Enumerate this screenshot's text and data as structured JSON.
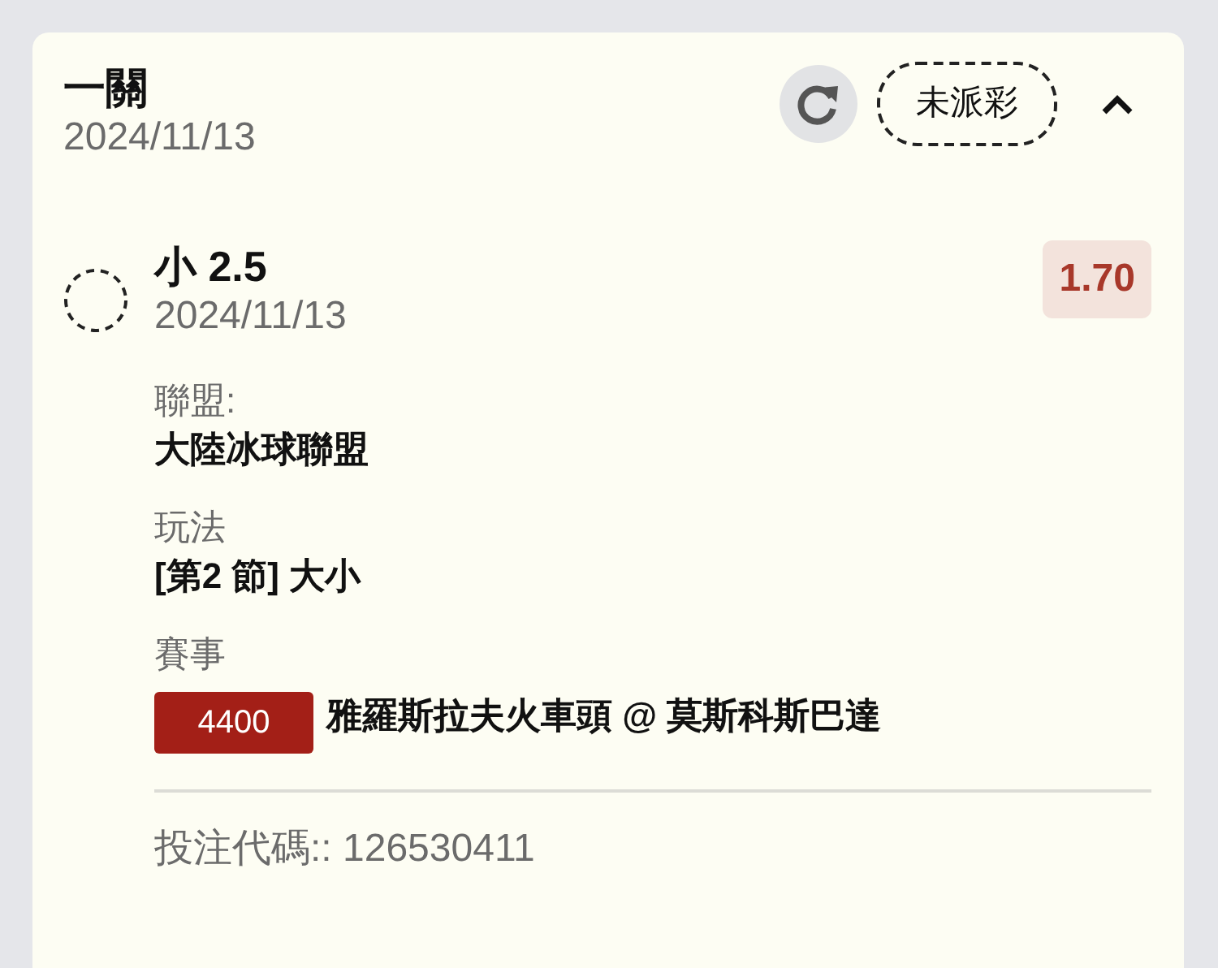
{
  "bet": {
    "title": "一關",
    "date": "2024/11/13",
    "status": "未派彩",
    "expanded": true
  },
  "selection": {
    "name": "小 2.5",
    "date": "2024/11/13",
    "odds": "1.70"
  },
  "details": [
    {
      "kind": "text",
      "label": "聯盟:",
      "value": "大陸冰球聯盟"
    },
    {
      "kind": "text",
      "label": "玩法",
      "value": "[第2 節] 大小"
    },
    {
      "kind": "event",
      "label": "賽事",
      "event_id": "4400",
      "value": "雅羅斯拉夫火車頭 @ 莫斯科斯巴達"
    }
  ],
  "bet_code": "投注代碼:: 126530411"
}
